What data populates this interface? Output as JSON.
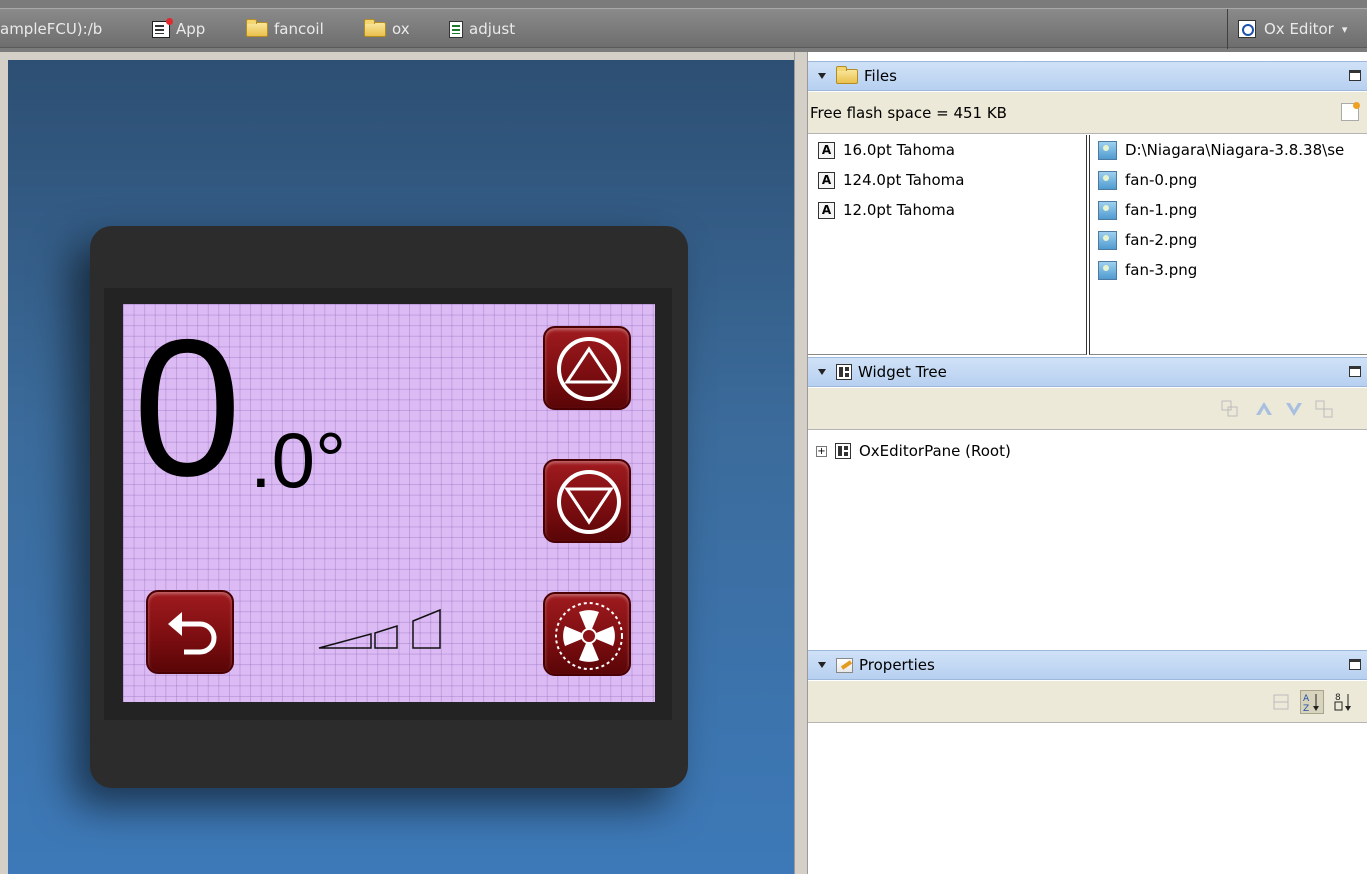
{
  "breadcrumb": {
    "station": "ampleFCU):/b",
    "items": [
      {
        "label": "App",
        "icon": "app-icon"
      },
      {
        "label": "fancoil",
        "icon": "folder-icon"
      },
      {
        "label": "ox",
        "icon": "folder-icon"
      },
      {
        "label": "adjust",
        "icon": "document-icon"
      }
    ]
  },
  "view_selector": {
    "label": "Ox Editor"
  },
  "device": {
    "temperature_integer": "0",
    "temperature_decimal": ".0°",
    "buttons": [
      "up",
      "down",
      "back",
      "fan"
    ],
    "screen_color": "#dcbbf4",
    "button_color": "#8b1216"
  },
  "files_panel": {
    "title": "Files",
    "free_space": "Free flash space = 451 KB",
    "fonts": [
      "16.0pt Tahoma",
      "124.0pt Tahoma",
      "12.0pt Tahoma"
    ],
    "images": [
      "D:\\Niagara\\Niagara-3.8.38\\se",
      "fan-0.png",
      "fan-1.png",
      "fan-2.png",
      "fan-3.png"
    ]
  },
  "widget_tree_panel": {
    "title": "Widget Tree",
    "root": "OxEditorPane (Root)"
  },
  "properties_panel": {
    "title": "Properties"
  }
}
